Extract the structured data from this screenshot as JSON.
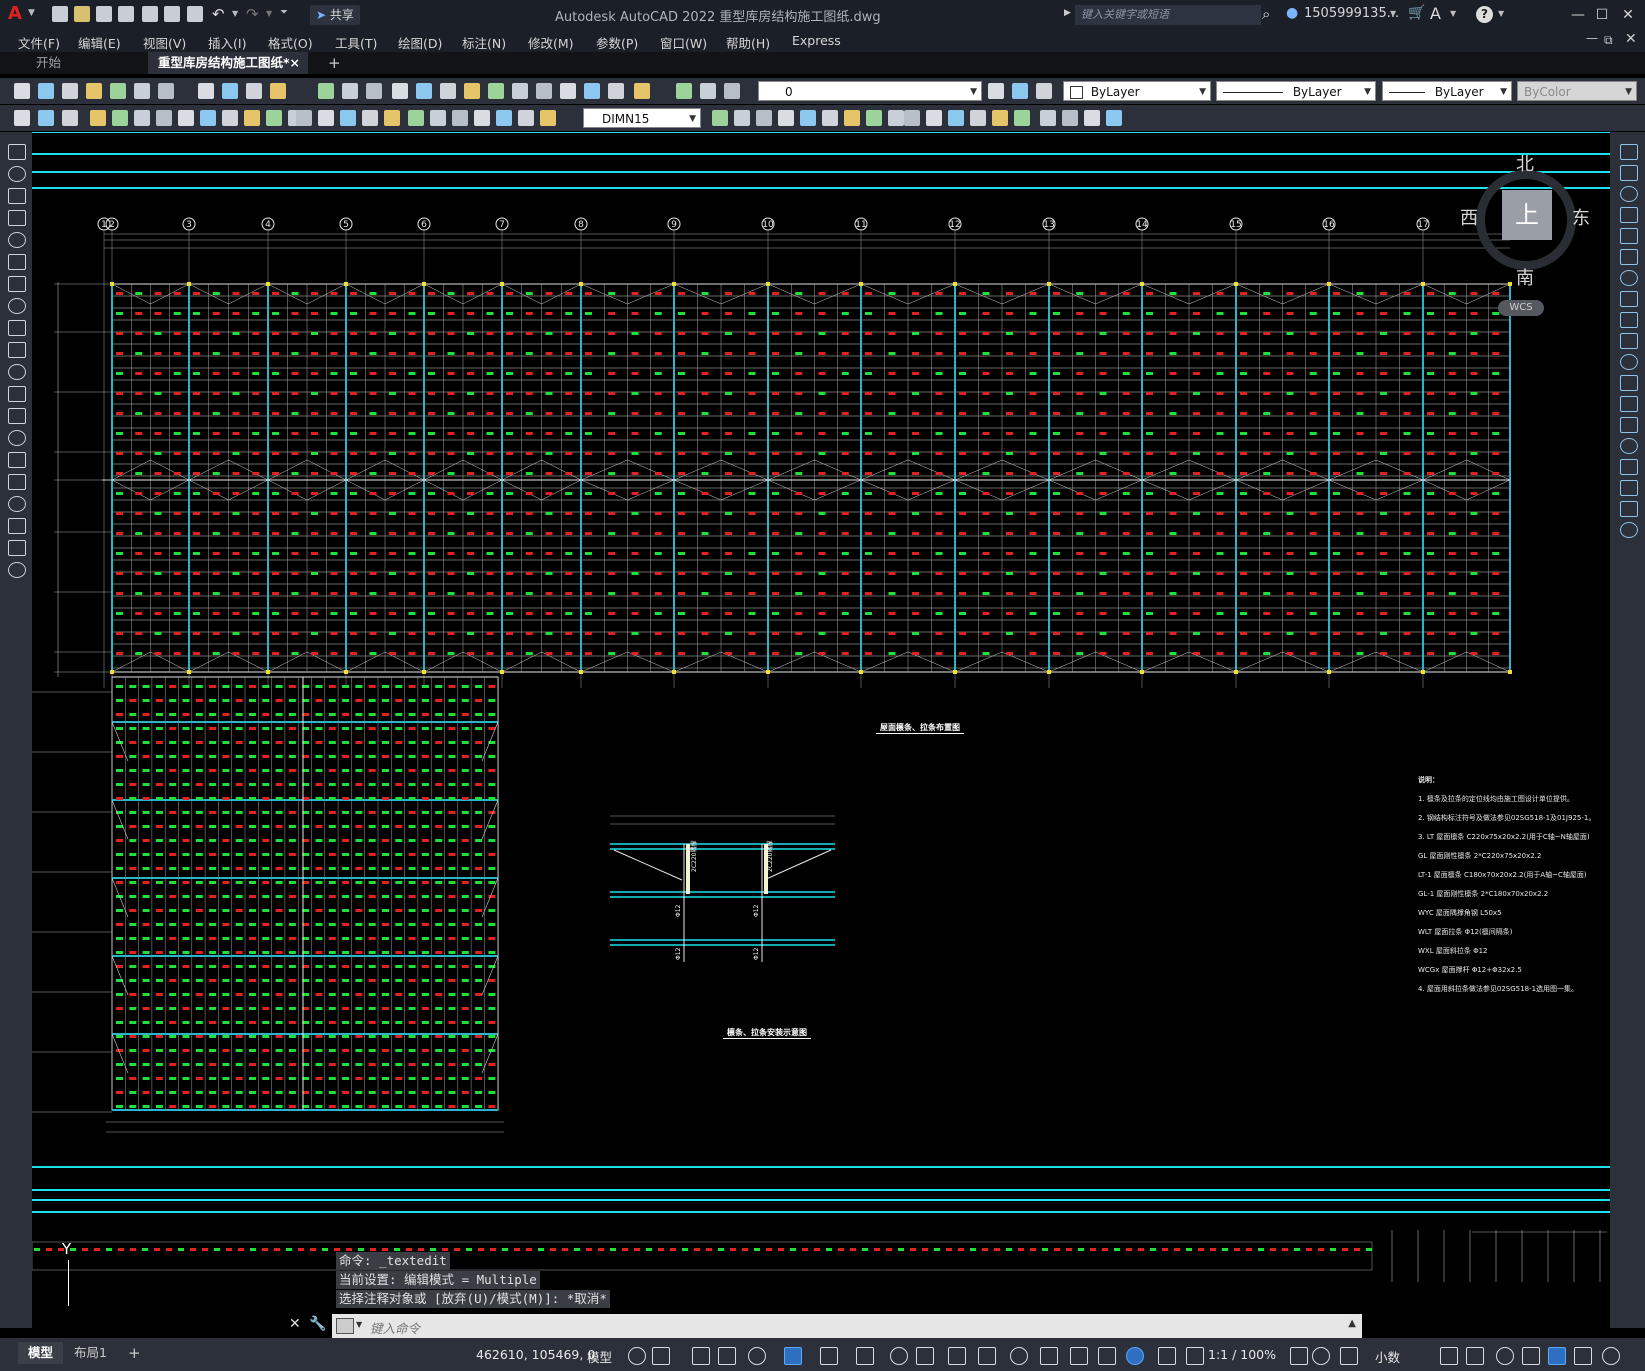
{
  "app": {
    "title": "Autodesk AutoCAD 2022    重型库房结构施工图纸.dwg",
    "logo": "A",
    "share_label": "共享",
    "search_placeholder": "键入关键字或短语",
    "user": "1505999135...",
    "help": "?"
  },
  "menu": [
    "文件(F)",
    "编辑(E)",
    "视图(V)",
    "插入(I)",
    "格式(O)",
    "工具(T)",
    "绘图(D)",
    "标注(N)",
    "修改(M)",
    "参数(P)",
    "窗口(W)",
    "帮助(H)",
    "Express"
  ],
  "tabs": {
    "start": "开始",
    "active": "重型库房结构施工图纸*",
    "close": "×",
    "add": "+"
  },
  "toolbar": {
    "layer_value": "0",
    "color_value": "ByLayer",
    "linetype_value": "ByLayer",
    "lineweight_value": "ByLayer",
    "plotstyle_value": "ByColor",
    "dimstyle_value": "DIMN15"
  },
  "drawing": {
    "grid_columns": [
      "1",
      "2",
      "3",
      "4",
      "5",
      "6",
      "7",
      "8",
      "9",
      "10",
      "11",
      "12",
      "13",
      "14",
      "15",
      "16",
      "17"
    ],
    "plan_title": "屋面檩条、拉条布置图",
    "detail_title": "檩条、拉条安装示意图",
    "detail_labels": [
      "2C220隅撑",
      "2C220隅撑",
      "Φ12",
      "Φ12",
      "Φ12",
      "Φ12"
    ],
    "notes_header": "说明：",
    "notes": [
      "1. 檩条及拉条的定位线均由施工图设计单位提供。",
      "2. 钢结构标注符号及做法参见02SG518-1及01J925-1。",
      "3. LT   屋面檩条  C220x75x20x2.2(用于C轴~N轴屋面)",
      "    GL   屋面刚性檩条  2*C220x75x20x2.2",
      "    LT-1   屋面檩条  C180x70x20x2.2(用于A轴~C轴屋面)",
      "    GL-1   屋面刚性檩条  2*C180x70x20x2.2",
      "    WYC   屋面隅撑角钢   L50x5",
      "    WLT   屋面拉条    Φ12(檩间隔条)",
      "    WXL   屋面斜拉条   Φ12",
      "    WCGx  屋面撑杆  Φ12+Φ32x2.5",
      "4. 屋面用斜拉条做法参见02SG518-1选用图一集。"
    ]
  },
  "viewcube": {
    "north": "北",
    "south": "南",
    "east": "东",
    "west": "西",
    "top": "上",
    "wcs": "WCS"
  },
  "ucs": {
    "y": "Y"
  },
  "command": {
    "history": [
      "命令: _textedit",
      "当前设置: 编辑模式 = Multiple",
      "选择注释对象或 [放弃(U)/模式(M)]: *取消*"
    ],
    "input_placeholder": "键入命令"
  },
  "status": {
    "model_tab": "模型",
    "layout_tab": "布局1",
    "add": "+",
    "coords": "462610, 105469, 0",
    "space": "模型",
    "scale": "1:1 / 100%",
    "units": "小数"
  },
  "colors": {
    "accent_cyan": "#1ee0e8",
    "grid_white": "#e8e8e8",
    "label_green": "#22e03a",
    "label_red": "#e02222",
    "frame_cyan": "#2ab6c8",
    "yellow": "#f0e030"
  }
}
